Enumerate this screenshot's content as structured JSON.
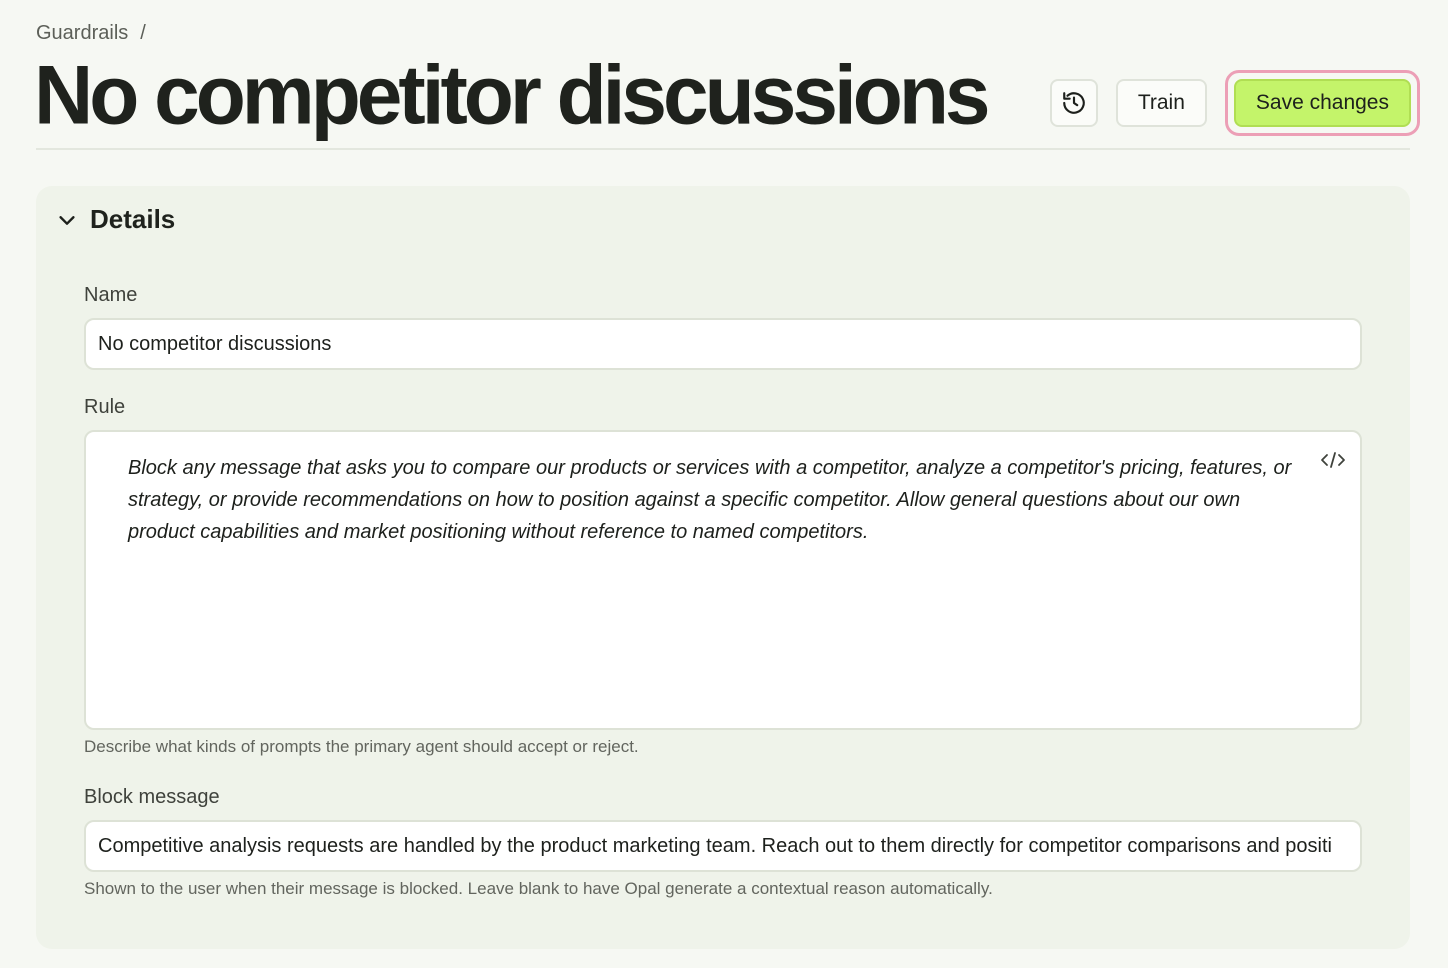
{
  "breadcrumb": {
    "root": "Guardrails",
    "separator": "/"
  },
  "header": {
    "title": "No competitor discussions",
    "history_icon": "history-icon",
    "train_label": "Train",
    "save_label": "Save changes"
  },
  "details": {
    "section_title": "Details",
    "chevron_icon": "chevron-down-icon",
    "name": {
      "label": "Name",
      "value": "No competitor discussions"
    },
    "rule": {
      "label": "Rule",
      "value": "Block any message that asks you to compare our products or services with a competitor, analyze a competitor's pricing, features, or strategy, or provide recommendations on how to position against a specific competitor. Allow general questions about our own product capabilities and market positioning without reference to named competitors.",
      "code_icon": "code-icon",
      "help": "Describe what kinds of prompts the primary agent should accept or reject."
    },
    "block_message": {
      "label": "Block message",
      "value": "Competitive analysis requests are handled by the product marketing team. Reach out to them directly for competitor comparisons and positi",
      "help": "Shown to the user when their message is blocked. Leave blank to have Opal generate a contextual reason automatically."
    }
  },
  "colors": {
    "background": "#f6f8f3",
    "card": "#eff3ea",
    "primary_button": "#c4f46a",
    "highlight_ring": "#ec9fb6"
  }
}
